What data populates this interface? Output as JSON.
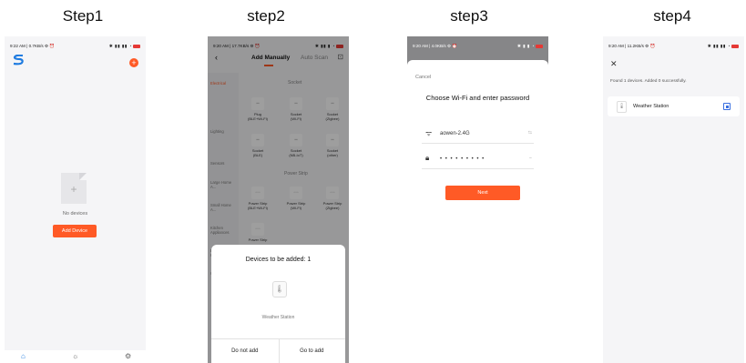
{
  "steps": {
    "step1_title": "Step1",
    "step2_title": "step2",
    "step3_title": "step3",
    "step4_title": "step4"
  },
  "step1": {
    "status_time": "9:22 AM | 0.7KB/s ⚙ ⏰",
    "status_icons": "✱ ▮▮ ▮▮ ◔",
    "empty_text": "No devices",
    "add_device_label": "Add Device",
    "tabs": [
      "⌂",
      "☼",
      "⚙"
    ],
    "accent_color": "#ff5a26"
  },
  "step2": {
    "status_time": "9:20 AM | 17.7KB/s ⚙ ⏰",
    "status_icons": "✱ ▮▮ ▮ ◔",
    "back": "‹",
    "tab_manual": "Add Manually",
    "tab_auto": "Auto Scan",
    "scan_icon": "⊡",
    "categories": [
      "Electrical",
      "Lighting",
      "Sensors",
      "Large Home A...",
      "Small Home A...",
      "Kitchen Appliances",
      "Exercise & Health",
      "Camera & Lock"
    ],
    "section_socket": "Socket",
    "section_power_strip": "Power Strip",
    "grid": [
      [
        "Plug",
        "(BLE+Wi-Fi)"
      ],
      [
        "Socket",
        "(Wi-Fi)"
      ],
      [
        "Socket",
        "(Zigbee)"
      ],
      [
        "Socket",
        "(BLE)"
      ],
      [
        "Socket",
        "(NB-IoT)"
      ],
      [
        "Socket",
        "(other)"
      ],
      [
        "Power Strip",
        "(BLE+Wi-Fi)"
      ],
      [
        "Power Strip",
        "(Wi-Fi)"
      ],
      [
        "Power Strip",
        "(Zigbee)"
      ],
      [
        "Power Strip",
        ""
      ]
    ],
    "sheet_title": "Devices to be added: 1",
    "sheet_device": "Weather Station",
    "do_not_add": "Do not add",
    "go_to_add": "Go to add"
  },
  "step3": {
    "status_time": "9:20 AM | 4.0KB/s ⚙ ⏰",
    "status_icons": "✱ ▮ ▮ ◔",
    "cancel": "Cancel",
    "title": "Choose Wi-Fi and enter password",
    "wifi_name": "aowen-2.4G",
    "wifi_trail": "⇆",
    "password": "• • • • • • • • •",
    "pwd_trail": "⌣",
    "next_label": "Next"
  },
  "step4": {
    "status_time": "9:20 AM | 11.2KB/s ⚙ ⏰",
    "status_icons": "✱ ▮▮ ▮▮ ◔",
    "close": "✕",
    "found_text": "Found 1 devices. Added 0 successfully.",
    "device_name": "Weather Station",
    "checkbox_color": "#3a6fe0"
  }
}
